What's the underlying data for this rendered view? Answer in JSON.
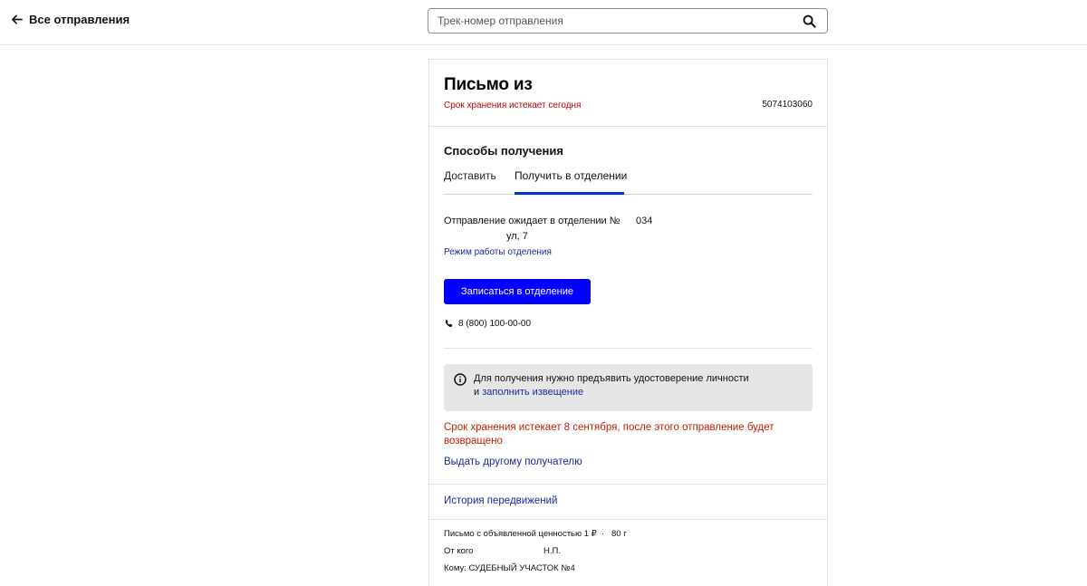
{
  "header": {
    "back_label": "Все отправления",
    "search_placeholder": "Трек-номер отправления"
  },
  "card": {
    "title": "Письмо из",
    "storage_expires_today": "Срок хранения истекает сегодня",
    "track_number": "5074103060",
    "methods_title": "Способы получения",
    "tabs": [
      {
        "label": "Доставить",
        "active": false
      },
      {
        "label": "Получить в отделении",
        "active": true
      }
    ],
    "office_waiting": "Отправление ожидает в отделении №",
    "office_number": "034",
    "office_street": "ул, 7",
    "office_hours_link": "Режим работы отделения",
    "signup_button": "Записаться в отделение",
    "phone": "8 (800) 100-00-00",
    "info_line1": "Для получения нужно предъявить удостоверение личности",
    "info_line2_prefix": "и",
    "info_line2_link": "заполнить извещение",
    "storage_expires_full": "Срок хранения истекает 8 сентября, после этого отправление будет возвращено",
    "other_recipient_link": "Выдать другому получателю",
    "history_link": "История передвижений",
    "details": {
      "type": "Письмо с объявленной ценностью 1 ₽",
      "dot": "·",
      "weight": "80 г",
      "from_label": "От кого",
      "from_name": "Н.П.",
      "to": "Кому: СУДЕБНЫЙ УЧАСТОК №4"
    }
  },
  "colors": {
    "accent_blue": "#0000ff",
    "link_blue": "#1a2a9a",
    "warning_red": "#c00000",
    "info_bg": "#e6e6e6"
  },
  "icons": {
    "back": "arrow-left-icon",
    "search": "search-icon",
    "phone": "phone-icon",
    "info": "info-circle-icon"
  }
}
